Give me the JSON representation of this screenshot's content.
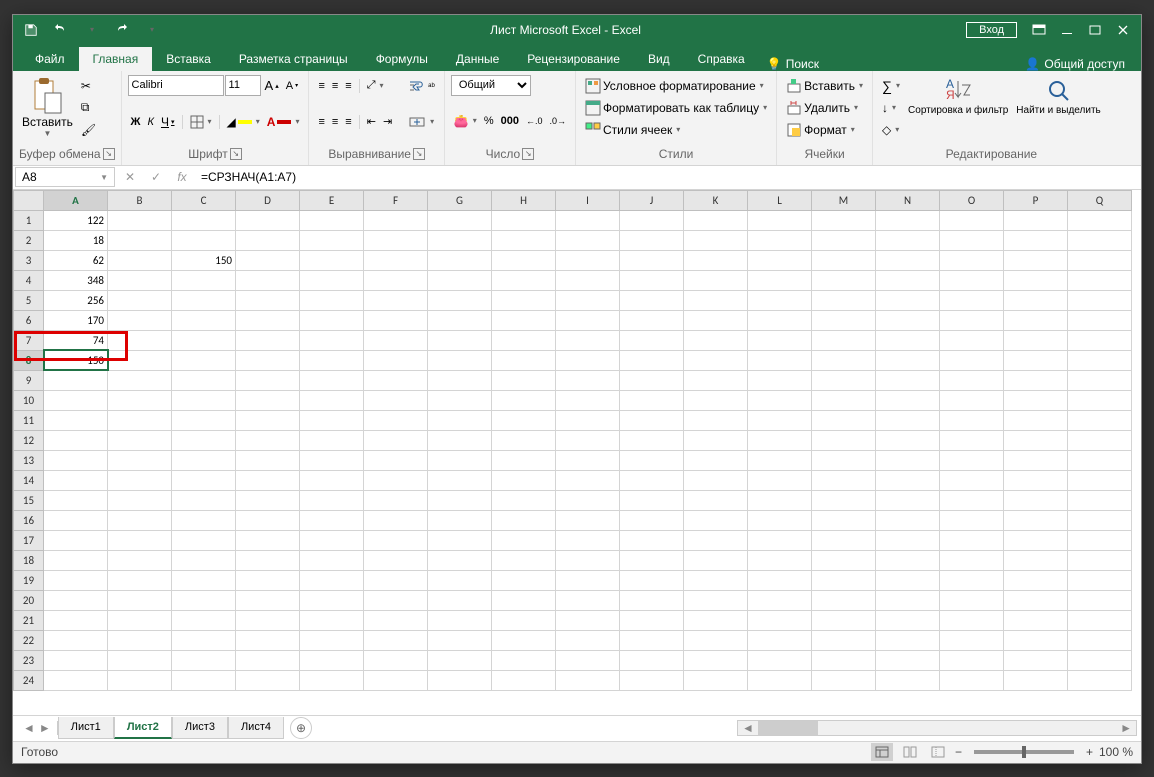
{
  "title": "Лист Microsoft Excel  -  Excel",
  "login": "Вход",
  "menu": {
    "file": "Файл",
    "home": "Главная",
    "insert": "Вставка",
    "page": "Разметка страницы",
    "formulas": "Формулы",
    "data": "Данные",
    "review": "Рецензирование",
    "view": "Вид",
    "help": "Справка",
    "tellme": "Поиск",
    "share": "Общий доступ"
  },
  "ribbon": {
    "clipboard": {
      "paste": "Вставить",
      "label": "Буфер обмена"
    },
    "font": {
      "name": "Calibri",
      "size": "11",
      "label": "Шрифт",
      "bold": "Ж",
      "italic": "К",
      "underline": "Ч"
    },
    "align": {
      "label": "Выравнивание",
      "wrap": "",
      "merge": ""
    },
    "number": {
      "format": "Общий",
      "label": "Число"
    },
    "styles": {
      "cond": "Условное форматирование",
      "table": "Форматировать как таблицу",
      "cell": "Стили ячеек",
      "label": "Стили"
    },
    "cells": {
      "insert": "Вставить",
      "delete": "Удалить",
      "format": "Формат",
      "label": "Ячейки"
    },
    "editing": {
      "sort": "Сортировка и фильтр",
      "find": "Найти и выделить",
      "label": "Редактирование"
    }
  },
  "namebox": "A8",
  "formula": "=СРЗНАЧ(A1:A7)",
  "columns": [
    "A",
    "B",
    "C",
    "D",
    "E",
    "F",
    "G",
    "H",
    "I",
    "J",
    "K",
    "L",
    "M",
    "N",
    "O",
    "P",
    "Q"
  ],
  "rows": [
    1,
    2,
    3,
    4,
    5,
    6,
    7,
    8,
    9,
    10,
    11,
    12,
    13,
    14,
    15,
    16,
    17,
    18,
    19,
    20,
    21,
    22,
    23,
    24
  ],
  "cells": {
    "A1": "122",
    "A2": "18",
    "A3": "62",
    "A4": "348",
    "A5": "256",
    "A6": "170",
    "A7": "74",
    "A8": "150",
    "C3": "150"
  },
  "active_cell": "A8",
  "sheets": [
    "Лист1",
    "Лист2",
    "Лист3",
    "Лист4"
  ],
  "active_sheet": "Лист2",
  "status": "Готово",
  "zoom": "100 %"
}
